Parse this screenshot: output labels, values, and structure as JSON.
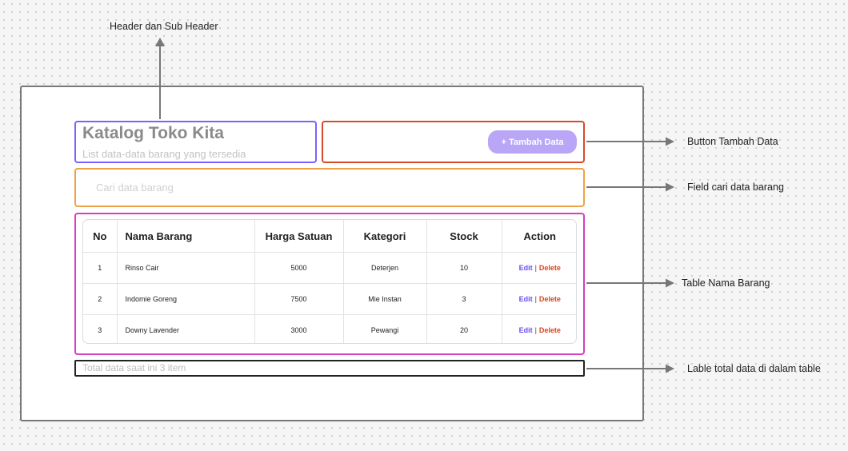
{
  "annotations": {
    "header": "Header dan Sub Header",
    "button": "Button Tambah Data",
    "search": "Field cari data barang",
    "table": "Table Nama Barang",
    "total": "Lable total data di dalam table"
  },
  "page": {
    "title": "Katalog Toko Kita",
    "subtitle": "List data-data barang yang tersedia",
    "add_button": "+ Tambah Data",
    "search_placeholder": "Cari data barang",
    "total_label": "Total data saat ini 3 item"
  },
  "table": {
    "headers": [
      "No",
      "Nama Barang",
      "Harga Satuan",
      "Kategori",
      "Stock",
      "Action"
    ],
    "rows": [
      {
        "no": "1",
        "nama": "Rinso Cair",
        "harga": "5000",
        "kategori": "Deterjen",
        "stock": "10"
      },
      {
        "no": "2",
        "nama": "Indomie Goreng",
        "harga": "7500",
        "kategori": "Mie Instan",
        "stock": "3"
      },
      {
        "no": "3",
        "nama": "Downy Lavender",
        "harga": "3000",
        "kategori": "Pewangi",
        "stock": "20"
      }
    ],
    "action_edit": "Edit",
    "action_separator": "|",
    "action_delete": "Delete"
  },
  "colors": {
    "header_outline": "#7b61ff",
    "button_outline": "#d64a2a",
    "search_outline": "#f0a045",
    "table_outline": "#d63fc0",
    "total_outline": "#222222",
    "button_fill": "#b9a6f7",
    "edit_link": "#6b4ef0",
    "delete_link": "#d8431f"
  }
}
